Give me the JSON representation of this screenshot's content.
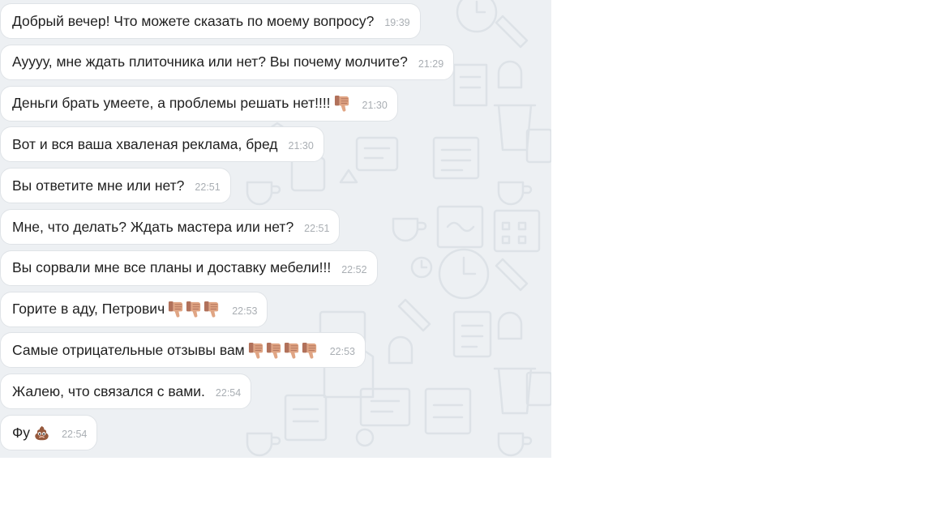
{
  "chat": {
    "messages": [
      {
        "text": "Добрый вечер! Что можете сказать по моему вопросу?",
        "time": "19:39",
        "emojis": []
      },
      {
        "text": "Ауууу, мне ждать плиточника или нет? Вы почему молчите?",
        "time": "21:29",
        "emojis": []
      },
      {
        "text": "Деньги брать умеете, а проблемы решать нет!!!!",
        "time": "21:30",
        "emojis": [
          "thumbs-down-icon"
        ]
      },
      {
        "text": "Вот и вся ваша хваленая реклама, бред",
        "time": "21:30",
        "emojis": []
      },
      {
        "text": "Вы ответите мне или нет?",
        "time": "22:51",
        "emojis": []
      },
      {
        "text": "Мне, что делать? Ждать мастера или нет?",
        "time": "22:51",
        "emojis": []
      },
      {
        "text": "Вы сорвали мне все планы и доставку мебели!!!",
        "time": "22:52",
        "emojis": []
      },
      {
        "text": "Горите в аду, Петрович",
        "time": "22:53",
        "emojis": [
          "thumbs-down-icon",
          "thumbs-down-icon",
          "thumbs-down-icon"
        ]
      },
      {
        "text": "Самые отрицательные отзывы вам",
        "time": "22:53",
        "emojis": [
          "thumbs-down-icon",
          "thumbs-down-icon",
          "thumbs-down-icon",
          "thumbs-down-icon"
        ]
      },
      {
        "text": "Жалею, что связался с вами.",
        "time": "22:54",
        "emojis": []
      },
      {
        "text": "Фу",
        "time": "22:54",
        "emojis": [
          "poop-icon"
        ]
      }
    ]
  },
  "colors": {
    "chat_background": "#edf0f3",
    "bubble": "#ffffff",
    "bubble_border": "#dfe3e7",
    "text": "#1f1f1f",
    "time": "#a9aeb3"
  }
}
